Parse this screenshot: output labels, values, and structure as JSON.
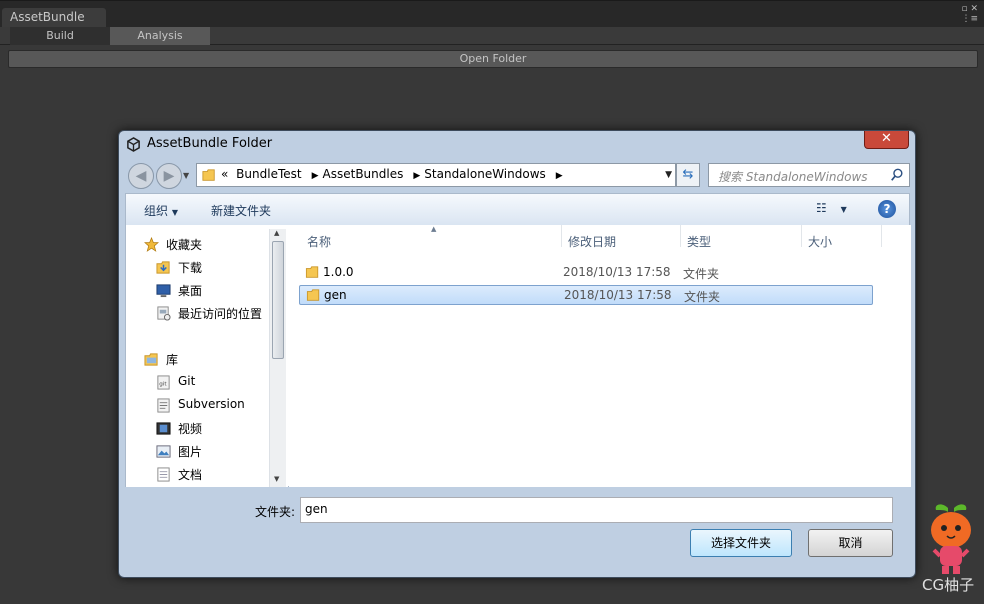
{
  "unity": {
    "window_tab": "AssetBundle",
    "tabs": [
      {
        "label": "Build",
        "active": false
      },
      {
        "label": "Analysis",
        "active": true
      }
    ],
    "open_folder_label": "Open Folder"
  },
  "dialog": {
    "title": "AssetBundle Folder",
    "address": {
      "overflow": "«",
      "crumbs": [
        "BundleTest",
        "AssetBundles",
        "StandaloneWindows"
      ]
    },
    "search_placeholder": "搜索 StandaloneWindows",
    "toolbar": {
      "organize_label": "组织",
      "new_folder_label": "新建文件夹"
    },
    "nav": {
      "favorites": {
        "label": "收藏夹",
        "items": [
          "下载",
          "桌面",
          "最近访问的位置"
        ]
      },
      "libraries": {
        "label": "库",
        "items": [
          "Git",
          "Subversion",
          "视频",
          "图片",
          "文档"
        ]
      }
    },
    "columns": [
      "名称",
      "修改日期",
      "类型",
      "大小"
    ],
    "files": [
      {
        "name": "1.0.0",
        "modified": "2018/10/13 17:58",
        "type": "文件夹",
        "selected": false
      },
      {
        "name": "gen",
        "modified": "2018/10/13 17:58",
        "type": "文件夹",
        "selected": true
      }
    ],
    "folder_field_label": "文件夹:",
    "folder_field_value": "gen",
    "select_button": "选择文件夹",
    "cancel_button": "取消"
  },
  "watermark": "CG柚子",
  "colors": {
    "unity_bg": "#383838",
    "dialog_frame": "#bfcfe2",
    "selection": "#c1dcfa",
    "close_red": "#c9493a"
  }
}
